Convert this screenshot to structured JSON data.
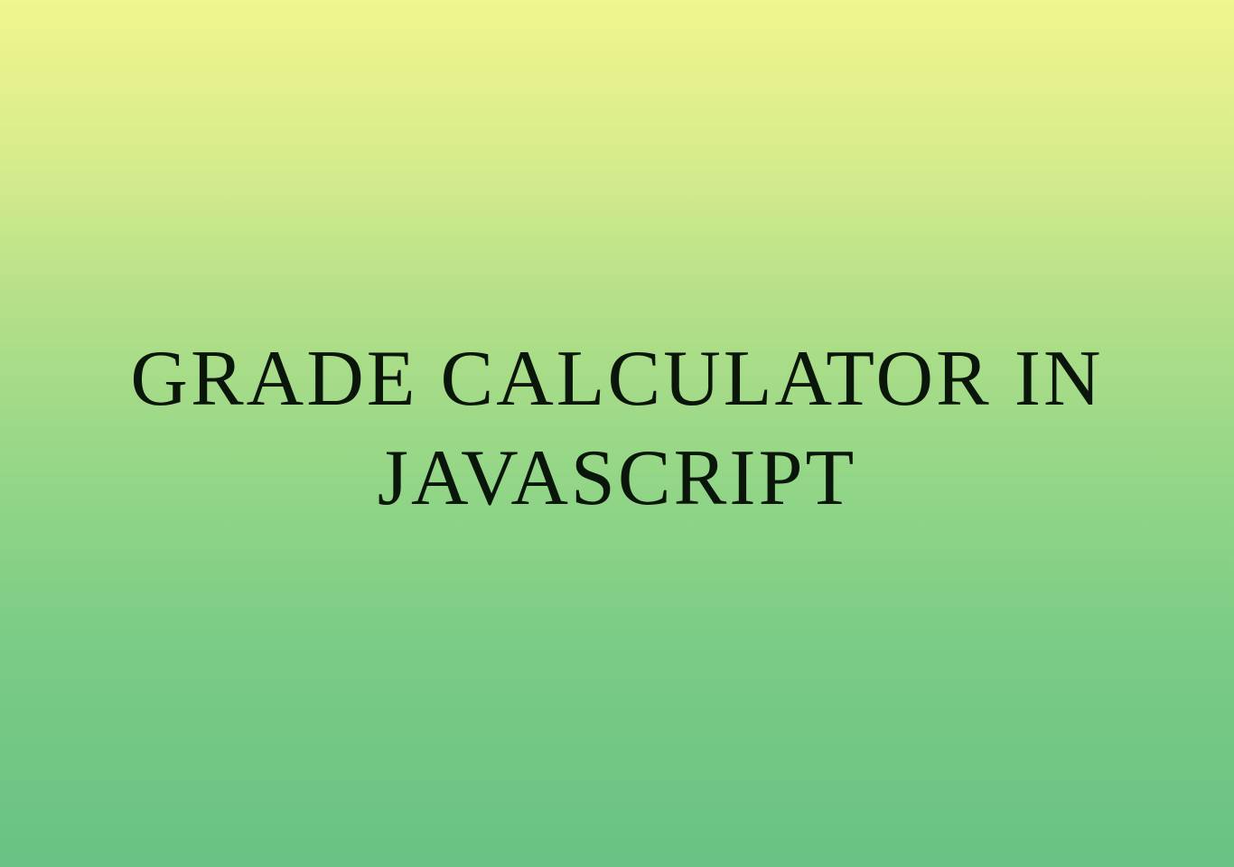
{
  "heading": {
    "line1": "GRADE CALCULATOR IN",
    "line2": "JAVASCRIPT"
  },
  "colors": {
    "gradient_top": "#f0f58e",
    "gradient_bottom": "#69c283",
    "text": "#0a160a"
  }
}
